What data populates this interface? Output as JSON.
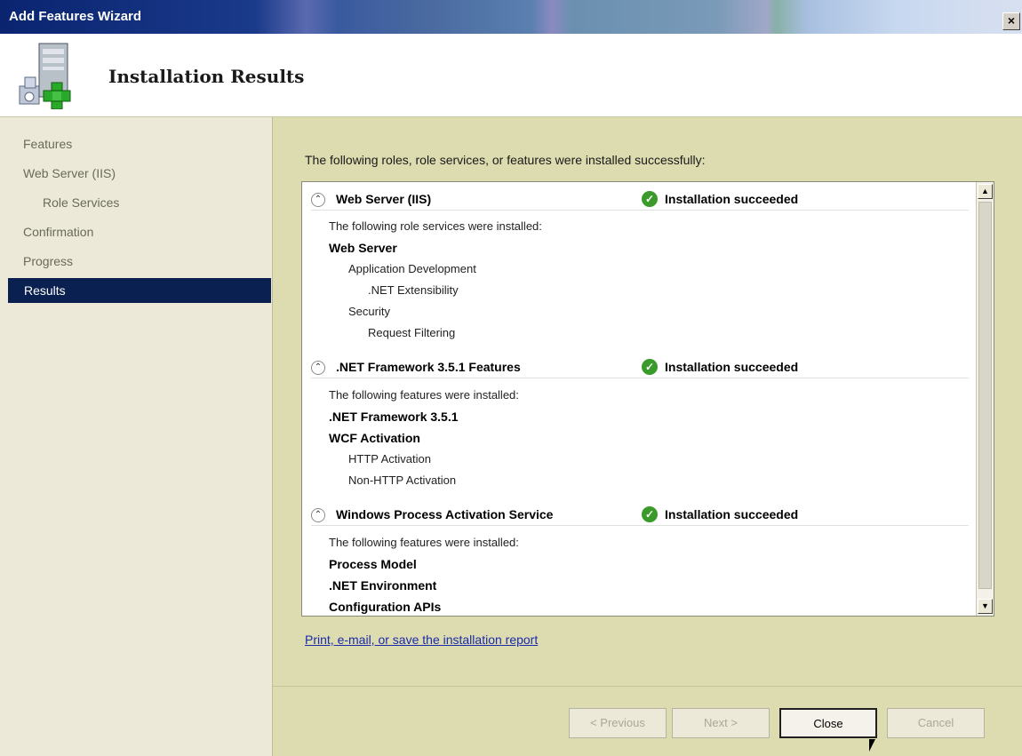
{
  "window": {
    "title": "Add Features Wizard",
    "close_glyph": "×"
  },
  "header": {
    "title": "Installation Results",
    "logo_icon": "server-add-icon"
  },
  "sidebar": {
    "items": [
      {
        "label": "Features"
      },
      {
        "label": "Web Server (IIS)"
      },
      {
        "label": "Role Services"
      },
      {
        "label": "Confirmation"
      },
      {
        "label": "Progress"
      },
      {
        "label": "Results"
      }
    ]
  },
  "main": {
    "intro": "The following roles, role services, or features were installed successfully:",
    "sections": [
      {
        "name": "Web Server (IIS)",
        "status": "Installation succeeded",
        "lines": [
          {
            "text": "The following role services were installed:"
          },
          {
            "text": "Web Server"
          },
          {
            "text": "Application Development"
          },
          {
            "text": ".NET Extensibility"
          },
          {
            "text": "Security"
          },
          {
            "text": "Request Filtering"
          }
        ]
      },
      {
        "name": ".NET Framework 3.5.1 Features",
        "status": "Installation succeeded",
        "lines": [
          {
            "text": "The following features were installed:"
          },
          {
            "text": ".NET Framework 3.5.1"
          },
          {
            "text": "WCF Activation"
          },
          {
            "text": "HTTP Activation"
          },
          {
            "text": "Non-HTTP Activation"
          }
        ]
      },
      {
        "name": "Windows Process Activation Service",
        "status": "Installation succeeded",
        "lines": [
          {
            "text": "The following features were installed:"
          },
          {
            "text": "Process Model"
          },
          {
            "text": ".NET Environment"
          },
          {
            "text": "Configuration APIs"
          }
        ]
      }
    ],
    "report_link": "Print, e-mail, or save the installation report"
  },
  "footer": {
    "previous": "< Previous",
    "next": "Next >",
    "close": "Close",
    "cancel": "Cancel"
  },
  "colors": {
    "active_nav_bg": "#0a2050",
    "success_green": "#3a9a2a",
    "link_blue": "#1a2aa8"
  }
}
